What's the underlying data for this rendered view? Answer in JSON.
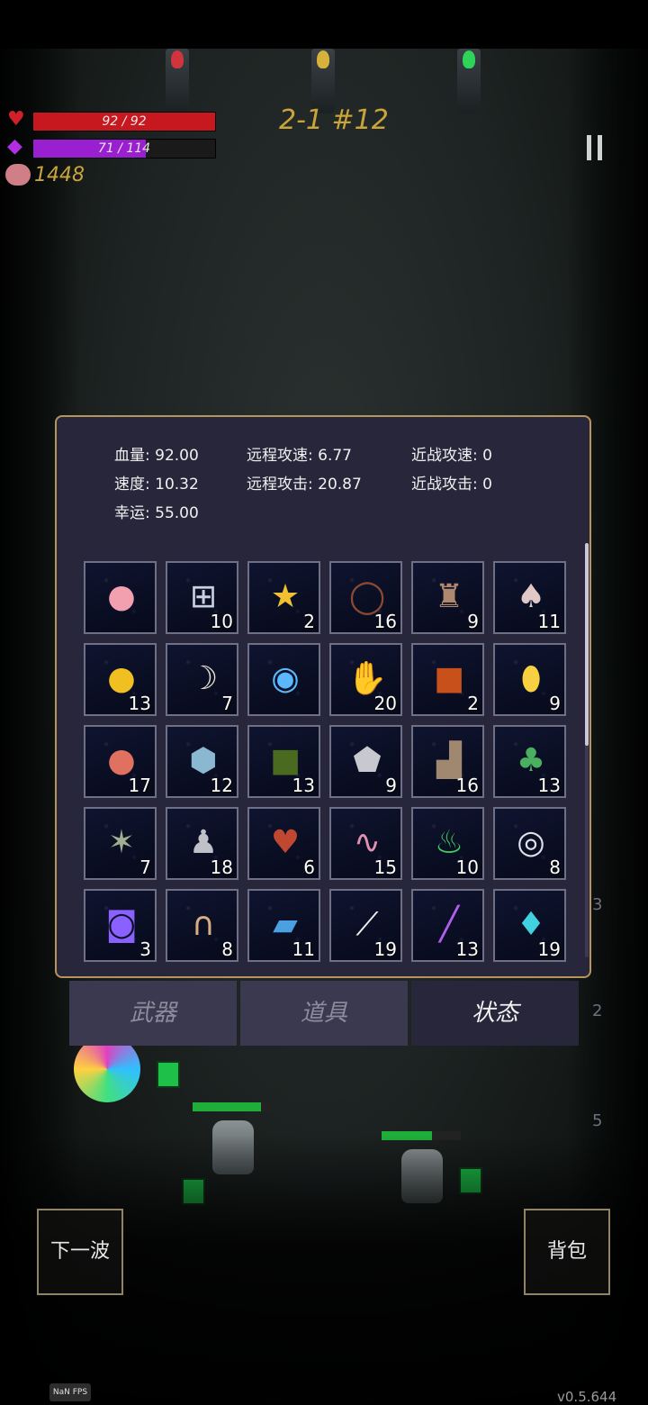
{
  "hud": {
    "hp_text": "92 / 92",
    "hp_fraction": 1.0,
    "mana_text": "71 / 114",
    "mana_fraction": 0.62,
    "gold": "1448",
    "wave": "2-1 #12",
    "icons": {
      "hp": "heart-icon",
      "mana": "mana-crystal-icon",
      "gold": "piggy-bank-icon",
      "pause": "pause-icon"
    },
    "colors": {
      "hp": "#c8181f",
      "mana": "#9a1fd0",
      "gold": "#c9a43a"
    }
  },
  "stats": [
    {
      "label": "血量:",
      "value": "92.00"
    },
    {
      "label": "远程攻速:",
      "value": "6.77"
    },
    {
      "label": "近战攻速:",
      "value": "0"
    },
    {
      "label": "速度:",
      "value": "10.32"
    },
    {
      "label": "远程攻击:",
      "value": "20.87"
    },
    {
      "label": "近战攻击:",
      "value": "0"
    },
    {
      "label": "幸运:",
      "value": "55.00"
    }
  ],
  "items": [
    {
      "icon": "piggy-bank-icon",
      "count": ""
    },
    {
      "icon": "medkit-icon",
      "count": "10"
    },
    {
      "icon": "star-trophy-icon",
      "count": "2"
    },
    {
      "icon": "thorn-crown-icon",
      "count": "16"
    },
    {
      "icon": "pouch-icon",
      "count": "9"
    },
    {
      "icon": "mushroom-icon",
      "count": "11"
    },
    {
      "icon": "gold-coin-icon",
      "count": "13"
    },
    {
      "icon": "horn-icon",
      "count": "7"
    },
    {
      "icon": "energy-orb-icon",
      "count": ""
    },
    {
      "icon": "gloves-icon",
      "count": "20"
    },
    {
      "icon": "spellbook-icon",
      "count": "2"
    },
    {
      "icon": "gold-crystal-icon",
      "count": "9"
    },
    {
      "icon": "apple-icon",
      "count": "17"
    },
    {
      "icon": "ice-rock-icon",
      "count": "12"
    },
    {
      "icon": "skull-book-icon",
      "count": "13"
    },
    {
      "icon": "stone-icon",
      "count": "9"
    },
    {
      "icon": "boots-icon",
      "count": "16"
    },
    {
      "icon": "clover-icon",
      "count": "13"
    },
    {
      "icon": "tentacle-icon",
      "count": "7"
    },
    {
      "icon": "cloak-icon",
      "count": "18"
    },
    {
      "icon": "heart-organ-icon",
      "count": "6"
    },
    {
      "icon": "worm-icon",
      "count": "15"
    },
    {
      "icon": "potion-icon",
      "count": "10"
    },
    {
      "icon": "rings-icon",
      "count": "8"
    },
    {
      "icon": "portal-icon",
      "count": "3"
    },
    {
      "icon": "horseshoe-icon",
      "count": "8"
    },
    {
      "icon": "blue-book-icon",
      "count": "11"
    },
    {
      "icon": "feather-icon",
      "count": "19"
    },
    {
      "icon": "wand-icon",
      "count": "13"
    },
    {
      "icon": "blue-crystal-icon",
      "count": "19"
    }
  ],
  "tabs": [
    {
      "label": "武器",
      "active": false
    },
    {
      "label": "道具",
      "active": false
    },
    {
      "label": "状态",
      "active": true
    }
  ],
  "buttons": {
    "next_wave": "下一波",
    "backpack": "背包"
  },
  "ghost_counts": [
    "3",
    "2",
    "5"
  ],
  "fps": "NaN FPS",
  "version": "v0.5.644"
}
